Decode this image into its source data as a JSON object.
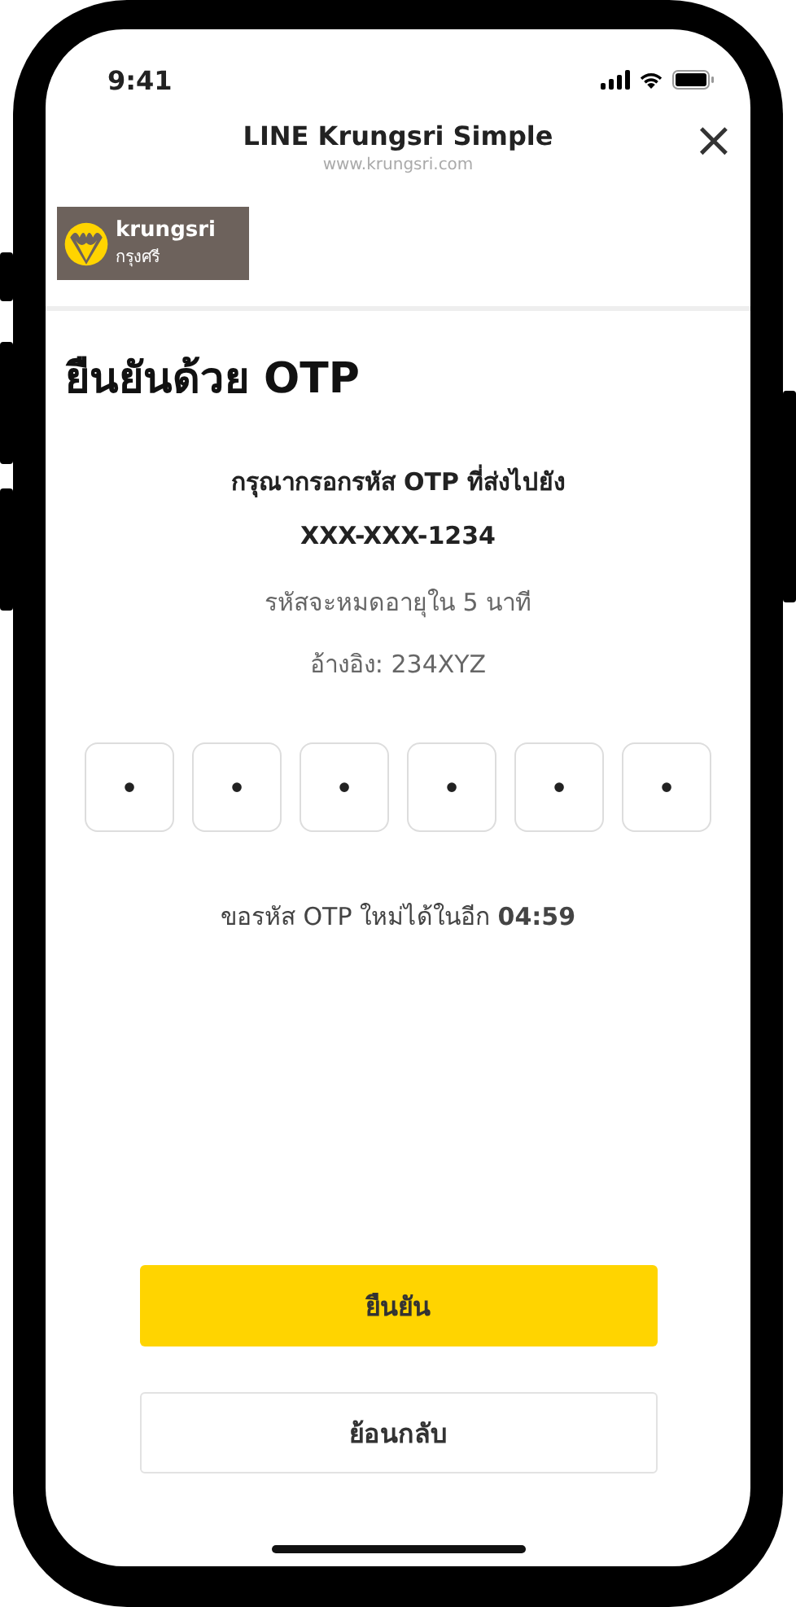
{
  "status_bar": {
    "time": "9:41"
  },
  "header": {
    "title": "LINE Krungsri Simple",
    "url": "www.krungsri.com",
    "close": "×"
  },
  "logo": {
    "name": "krungsri",
    "name_thai": "กรุงศรี"
  },
  "title": "ยืนยันด้วย OTP",
  "instruction": "กรุณากรอกรหัส OTP ที่ส่งไปยัง",
  "phone": "XXX-XXX-1234",
  "expiry": "รหัสจะหมดอายุใน 5 นาที",
  "reference": "อ้างอิง: 234XYZ",
  "otp_boxes": [
    {
      "value": "•"
    },
    {
      "value": "•"
    },
    {
      "value": "•"
    },
    {
      "value": "•"
    },
    {
      "value": "•"
    },
    {
      "value": "•"
    }
  ],
  "resend": "ขอรหัส OTP ใหม่ได้ในอีก **04:59**",
  "buttons": [
    {
      "label": "ยืนยัน",
      "kind": "primary"
    },
    {
      "label": "ย้อนกลับ",
      "kind": "secondary"
    }
  ]
}
